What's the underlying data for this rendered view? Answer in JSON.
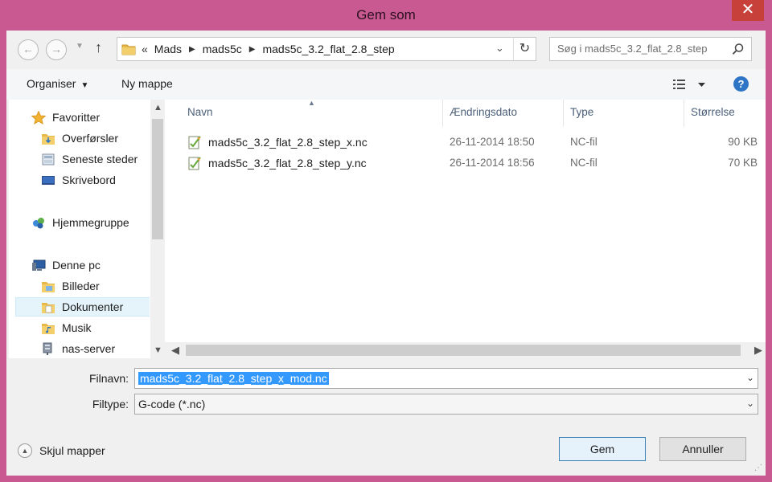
{
  "window": {
    "title": "Gem som",
    "close_glyph": "✕"
  },
  "nav": {
    "back_icon": "back-arrow-icon",
    "forward_icon": "forward-arrow-icon",
    "up_icon": "up-arrow-icon",
    "breadcrumb_prefix": "«",
    "breadcrumbs": [
      "Mads",
      "mads5c",
      "mads5c_3.2_flat_2.8_step"
    ],
    "search_placeholder": "Søg i mads5c_3.2_flat_2.8_step"
  },
  "toolbar": {
    "organise_label": "Organiser",
    "new_folder_label": "Ny mappe",
    "help_glyph": "?"
  },
  "sidebar": {
    "items": [
      {
        "label": "Favoritter",
        "icon": "star-icon"
      },
      {
        "label": "Overførsler",
        "icon": "downloads-folder-icon"
      },
      {
        "label": "Seneste steder",
        "icon": "recent-places-icon"
      },
      {
        "label": "Skrivebord",
        "icon": "desktop-icon"
      },
      {
        "label": "Hjemmegruppe",
        "icon": "homegroup-icon"
      },
      {
        "label": "Denne pc",
        "icon": "computer-icon"
      },
      {
        "label": "Billeder",
        "icon": "pictures-folder-icon"
      },
      {
        "label": "Dokumenter",
        "icon": "documents-folder-icon",
        "selected": true
      },
      {
        "label": "Musik",
        "icon": "music-folder-icon"
      },
      {
        "label": "nas-server",
        "icon": "network-server-icon"
      }
    ]
  },
  "file_list": {
    "columns": [
      "Navn",
      "Ændringsdato",
      "Type",
      "Størrelse"
    ],
    "rows": [
      {
        "name": "mads5c_3.2_flat_2.8_step_x.nc",
        "date": "26-11-2014 18:50",
        "type": "NC-fil",
        "size": "90 KB"
      },
      {
        "name": "mads5c_3.2_flat_2.8_step_y.nc",
        "date": "26-11-2014 18:56",
        "type": "NC-fil",
        "size": "70 KB"
      }
    ]
  },
  "form": {
    "filename_label": "Filnavn:",
    "filename_value": "mads5c_3.2_flat_2.8_step_x_mod.nc",
    "filetype_label": "Filtype:",
    "filetype_value": "G-code (*.nc)"
  },
  "footer": {
    "hide_folders_label": "Skjul mapper",
    "save_label": "Gem",
    "cancel_label": "Annuller"
  },
  "colors": {
    "window_frame": "#c95a91",
    "selection": "#3399ff",
    "sidebar_selected": "#e5f3fb",
    "primary_button_border": "#3c7fb1"
  }
}
